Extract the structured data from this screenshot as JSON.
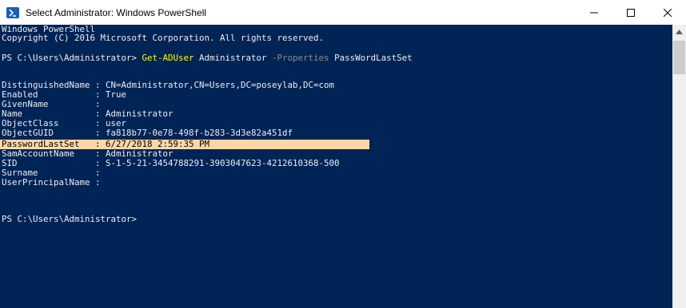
{
  "window": {
    "title": "Select Administrator: Windows PowerShell",
    "controls": {
      "minimize": "minimize-icon",
      "maximize": "maximize-icon",
      "close": "close-icon"
    }
  },
  "console": {
    "banner_line1": "Windows PowerShell",
    "banner_line2": "Copyright (C) 2016 Microsoft Corporation. All rights reserved.",
    "prompt": "PS C:\\Users\\Administrator> ",
    "command": {
      "cmdlet": "Get-ADUser",
      "argument": " Administrator ",
      "parameter": "-Properties",
      "value": " PassWordLastSet"
    },
    "properties": [
      {
        "name": "DistinguishedName",
        "value": "CN=Administrator,CN=Users,DC=poseylab,DC=com"
      },
      {
        "name": "Enabled",
        "value": "True"
      },
      {
        "name": "GivenName",
        "value": ""
      },
      {
        "name": "Name",
        "value": "Administrator"
      },
      {
        "name": "ObjectClass",
        "value": "user"
      },
      {
        "name": "ObjectGUID",
        "value": "fa818b77-0e78-498f-b283-3d3e82a451df"
      },
      {
        "name": "PasswordLastSet",
        "value": "6/27/2018 2:59:35 PM"
      },
      {
        "name": "SamAccountName",
        "value": "Administrator"
      },
      {
        "name": "SID",
        "value": "S-1-5-21-3454788291-3903047623-4212610368-500"
      },
      {
        "name": "Surname",
        "value": ""
      },
      {
        "name": "UserPrincipalName",
        "value": ""
      }
    ],
    "final_prompt": "PS C:\\Users\\Administrator>",
    "highlighted_property": "PasswordLastSet"
  },
  "colors": {
    "console_background": "#012456",
    "console_text": "#eeedf0",
    "cmdlet": "#ffff00",
    "parameter": "#8c8c8c",
    "selection_highlight": "#fbd7a6"
  }
}
